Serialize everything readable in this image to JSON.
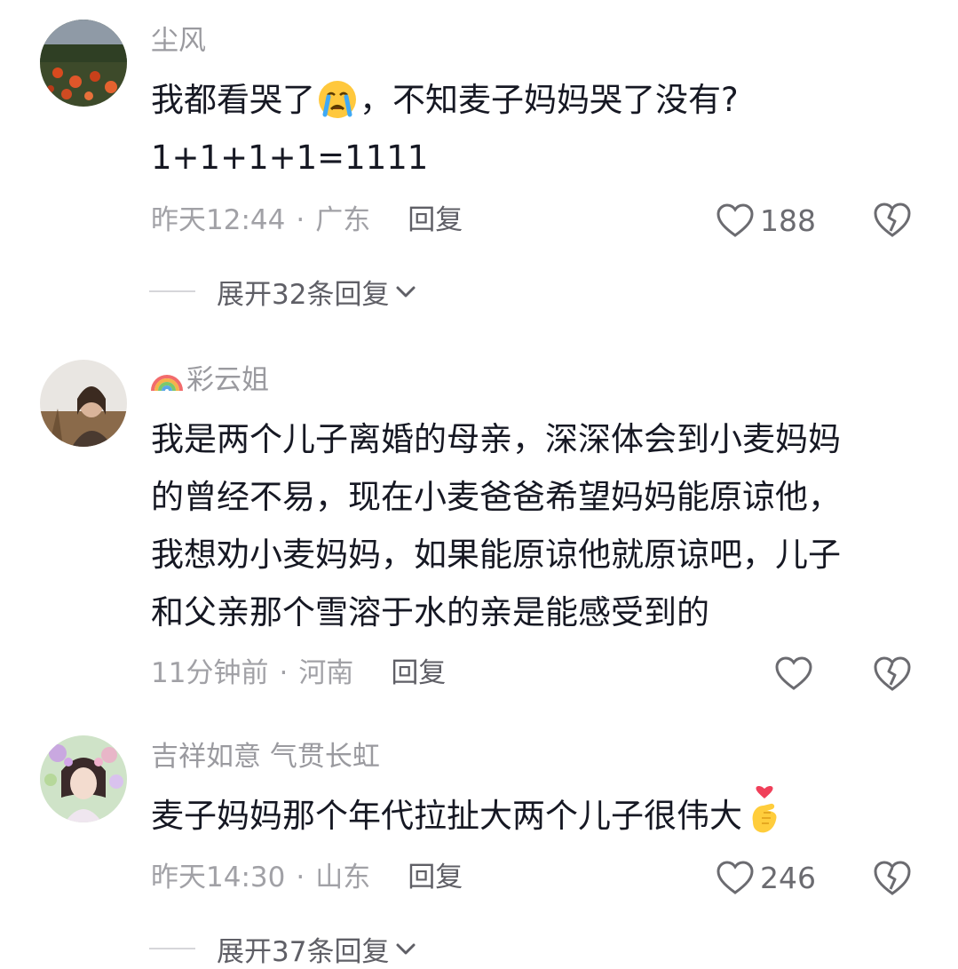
{
  "comments": [
    {
      "username": "尘风",
      "text_line1_before": "我都看哭了",
      "text_line1_after": "，不知麦子妈妈哭了没有?",
      "text_line2": "1+1+1+1=1111",
      "emoji": "crying-face",
      "time": "昨天12:44",
      "dot": "·",
      "location": "广东",
      "reply": "回复",
      "likes": "188",
      "expand": "展开32条回复"
    },
    {
      "username": "彩云姐",
      "username_icon": "rainbow",
      "lines": [
        "我是两个儿子离婚的母亲，深深体会到小麦妈妈",
        "的曾经不易，现在小麦爸爸希望妈妈能原谅他，",
        "我想劝小麦妈妈，如果能原谅他就原谅吧，儿子",
        "和父亲那个雪溶于水的亲是能感受到的"
      ],
      "time": "11分钟前",
      "dot": "·",
      "location": "河南",
      "reply": "回复"
    },
    {
      "username": "吉祥如意 气贯长虹",
      "text": "麦子妈妈那个年代拉扯大两个儿子很伟大",
      "emoji": "hand-with-heart",
      "time": "昨天14:30",
      "dot": "·",
      "location": "山东",
      "reply": "回复",
      "likes": "246",
      "expand": "展开37条回复"
    }
  ],
  "colors": {
    "text": "#161823",
    "meta": "#a1a1a6",
    "reply": "#5f5f66"
  }
}
